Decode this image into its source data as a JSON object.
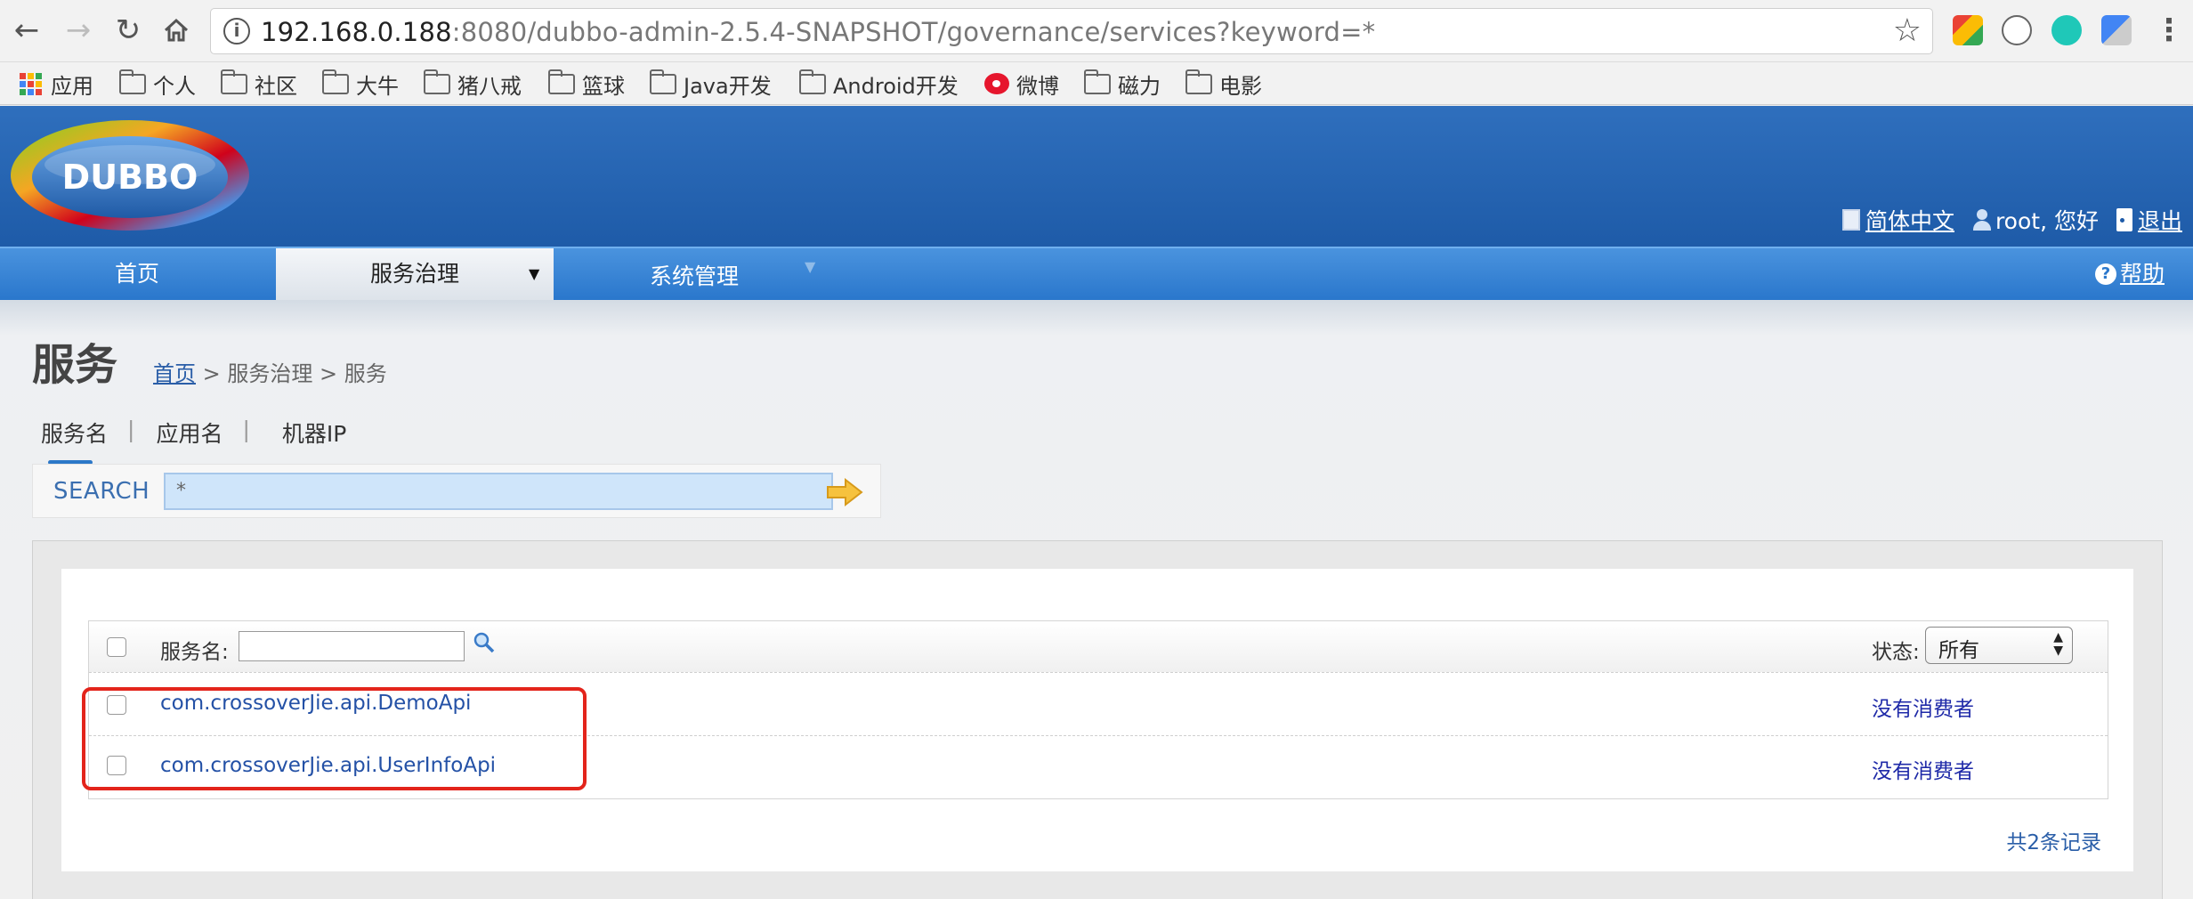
{
  "browser": {
    "url_host": "192.168.0.188",
    "url_rest": ":8080/dubbo-admin-2.5.4-SNAPSHOT/governance/services?keyword=*",
    "back_icon": "arrow-left-icon",
    "forward_icon": "arrow-right-icon",
    "reload_icon": "reload-icon",
    "home_icon": "home-icon",
    "bookmarks": [
      "应用",
      "个人",
      "社区",
      "大牛",
      "猪八戒",
      "篮球",
      "Java开发",
      "Android开发",
      "微博",
      "磁力",
      "电影"
    ]
  },
  "header": {
    "logo_text": "DUBBO",
    "lang_link": "简体中文",
    "user_greeting": "root, 您好",
    "logout_link": "退出"
  },
  "menu": {
    "items": [
      "首页",
      "服务治理",
      "系统管理"
    ],
    "help": "帮助"
  },
  "page": {
    "title": "服务",
    "breadcrumb_home": "首页",
    "breadcrumb_rest": " > 服务治理 > 服务"
  },
  "tabs": [
    "服务名",
    "应用名",
    "机器IP"
  ],
  "tab_separator": "|",
  "search": {
    "label": "SEARCH",
    "value": "*"
  },
  "table": {
    "filter_label": "服务名:",
    "status_label": "状态:",
    "status_value": "所有",
    "rows": [
      {
        "service": "com.crossoverJie.api.DemoApi",
        "status": "没有消费者"
      },
      {
        "service": "com.crossoverJie.api.UserInfoApi",
        "status": "没有消费者"
      }
    ],
    "total": "共2条记录"
  },
  "colors": {
    "header_blue": "#1e5ba8",
    "menu_blue": "#2a77cc",
    "link_blue": "#2451a6",
    "highlight_red": "#e3241b"
  }
}
